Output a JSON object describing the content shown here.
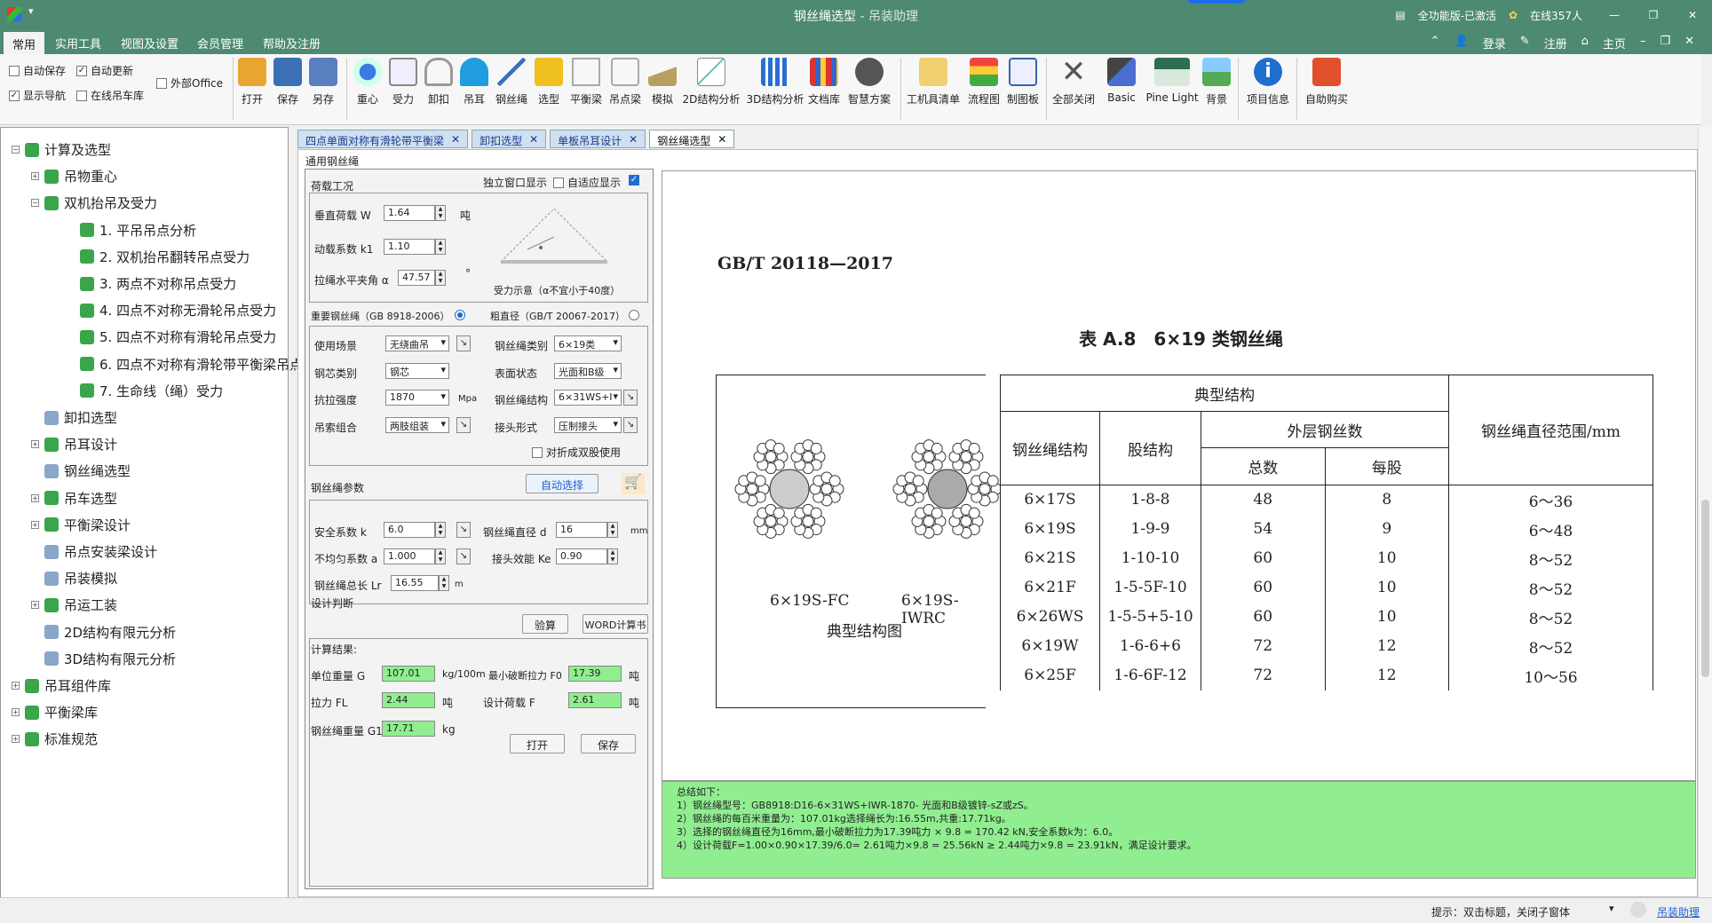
{
  "titlebar": {
    "title": "钢丝绳选型",
    "subtitle": "- 吊装助理",
    "version": "全功能版-已激活",
    "online": "在线357人"
  },
  "menu": {
    "items": [
      "常用",
      "实用工具",
      "视图及设置",
      "会员管理",
      "帮助及注册"
    ],
    "links": [
      "登录",
      "注册",
      "主页"
    ]
  },
  "ribbon": {
    "checks": [
      {
        "label": "自动保存",
        "checked": false
      },
      {
        "label": "自动更新",
        "checked": true
      },
      {
        "label": "外部Office",
        "checked": false
      },
      {
        "label": "显示导航",
        "checked": true
      },
      {
        "label": "在线吊车库",
        "checked": false
      }
    ],
    "buttons": [
      "打开",
      "保存",
      "另存",
      "重心",
      "受力",
      "卸扣",
      "吊耳",
      "钢丝绳",
      "选型",
      "平衡梁",
      "吊点梁",
      "模拟",
      "2D结构分析",
      "3D结构分析",
      "文档库",
      "智慧方案",
      "工机具清单",
      "流程图",
      "制图板",
      "全部关闭",
      "Basic",
      "Pine Light",
      "背景",
      "项目信息",
      "自助购买"
    ]
  },
  "tree": [
    {
      "label": "计算及选型",
      "level": 0,
      "exp": "−"
    },
    {
      "label": "吊物重心",
      "level": 1,
      "exp": "+"
    },
    {
      "label": "双机抬吊及受力",
      "level": 1,
      "exp": "−"
    },
    {
      "label": "1. 平吊吊点分析",
      "level": 2
    },
    {
      "label": "2. 双机抬吊翻转吊点受力",
      "level": 2
    },
    {
      "label": "3. 两点不对称吊点受力",
      "level": 2
    },
    {
      "label": "4. 四点不对称无滑轮吊点受力",
      "level": 2
    },
    {
      "label": "5. 四点不对称有滑轮吊点受力",
      "level": 2
    },
    {
      "label": "6. 四点不对称有滑轮带平衡梁吊点",
      "level": 2
    },
    {
      "label": "7. 生命线（绳）受力",
      "level": 2
    },
    {
      "label": "卸扣选型",
      "level": 1
    },
    {
      "label": "吊耳设计",
      "level": 1,
      "exp": "+"
    },
    {
      "label": "钢丝绳选型",
      "level": 1
    },
    {
      "label": "吊车选型",
      "level": 1,
      "exp": "+"
    },
    {
      "label": "平衡梁设计",
      "level": 1,
      "exp": "+"
    },
    {
      "label": "吊点安装梁设计",
      "level": 1
    },
    {
      "label": "吊装模拟",
      "level": 1
    },
    {
      "label": "吊运工装",
      "level": 1,
      "exp": "+"
    },
    {
      "label": "2D结构有限元分析",
      "level": 1
    },
    {
      "label": "3D结构有限元分析",
      "level": 1
    },
    {
      "label": "吊耳组件库",
      "level": 0,
      "exp": "+"
    },
    {
      "label": "平衡梁库",
      "level": 0,
      "exp": "+"
    },
    {
      "label": "标准规范",
      "level": 0,
      "exp": "+"
    }
  ],
  "tabs": [
    "四点单面对称有滑轮带平衡梁",
    "卸扣选型",
    "单板吊耳设计",
    "钢丝绳选型"
  ],
  "form": {
    "panel_title": "通用钢丝绳",
    "load_section": "荷载工况",
    "independent_window": "独立窗口显示",
    "adaptive": "自适应显示",
    "vertical_load_label": "垂直荷载 W",
    "vertical_load": "1.64",
    "unit_t": "吨",
    "dyn_label": "动载系数 k1",
    "dyn": "1.10",
    "angle_label": "拉绳水平夹角 α",
    "angle": "47.57",
    "deg": "°",
    "diagram_caption": "受力示意（α不宜小于40度）",
    "std1": "重要钢丝绳（GB 8918-2006）",
    "std2": "粗直径（GB/T 20067-2017）",
    "usage_label": "使用场景",
    "usage": "无绕曲吊",
    "rope_type_label": "钢丝绳类别",
    "rope_type": "6×19类",
    "core_label": "钢芯类别",
    "core": "钢芯",
    "surface_label": "表面状态",
    "surface": "光面和B级",
    "strength_label": "抗拉强度",
    "strength": "1870",
    "mpa": "Mpa",
    "structure_label": "钢丝绳结构",
    "structure": "6×31WS+I",
    "combo_label": "吊索组合",
    "combo": "两肢组装",
    "joint_label": "接头形式",
    "joint": "压制接头",
    "fold": "对折成双股使用",
    "params_section": "钢丝绳参数",
    "auto_select": "自动选择",
    "safety_label": "安全系数 k",
    "safety": "6.0",
    "diameter_label": "钢丝绳直径 d",
    "diameter": "16",
    "mm": "mm",
    "uneven_label": "不均匀系数 a",
    "uneven": "1.000",
    "eff_label": "接头效能 Ke",
    "eff": "0.90",
    "length_label": "钢丝绳总长 Lr",
    "length": "16.55",
    "m": "m",
    "design_judge": "设计判断",
    "verify": "验算",
    "word": "WORD计算书",
    "results_title": "计算结果:",
    "unit_weight_label": "单位重量 G",
    "unit_weight": "107.01",
    "unit_weight_unit": "kg/100m",
    "min_break_label": "最小破断拉力 F0",
    "min_break": "17.39",
    "t": "吨",
    "tension_label": "拉力 FL",
    "tension": "2.44",
    "design_load_label": "设计荷载 F",
    "design_load": "2.61",
    "rope_weight_label": "钢丝绳重量 G1",
    "rope_weight": "17.71",
    "kg": "kg",
    "open": "打开",
    "save": "保存"
  },
  "doc": {
    "std": "GB/T 20118—2017",
    "table_title": "表 A.8　6×19 类钢丝绳",
    "header_typical": "典型结构",
    "header_rope": "钢丝绳结构",
    "header_strand": "股结构",
    "header_outer": "外层钢丝数",
    "header_total": "总数",
    "header_per": "每股",
    "header_range": "钢丝绳直径范围/mm",
    "fig1": "6×19S-FC",
    "fig2": "6×19S-IWRC",
    "fig_caption": "典型结构图",
    "rows": [
      [
        "6×17S",
        "1-8-8",
        "48",
        "8",
        "6～36"
      ],
      [
        "6×19S",
        "1-9-9",
        "54",
        "9",
        "6～48"
      ],
      [
        "6×21S",
        "1-10-10",
        "60",
        "10",
        "8～52"
      ],
      [
        "6×21F",
        "1-5-5F-10",
        "60",
        "10",
        "8～52"
      ],
      [
        "6×26WS",
        "1-5-5+5-10",
        "60",
        "10",
        "8～52"
      ],
      [
        "6×19W",
        "1-6-6+6",
        "72",
        "12",
        "8～52"
      ],
      [
        "6×25F",
        "1-6-6F-12",
        "72",
        "12",
        "10～56"
      ]
    ]
  },
  "summary": {
    "title": "总结如下：",
    "lines": [
      "1）钢丝绳型号：GB8918:D16-6×31WS+IWR-1870- 光面和B级镀锌-sZ或zS。",
      "2）钢丝绳的每百米重量为：107.01kg选择绳长为:16.55m,共重:17.71kg。",
      "3）选择的钢丝绳直径为16mm,最小破断拉力为17.39吨力 × 9.8 = 170.42 kN,安全系数k为：6.0。",
      "4）设计荷载F=1.00×0.90×17.39/6.0= 2.61吨力×9.8 = 25.56kN ≥ 2.44吨力×9.8 = 23.91kN，满足设计要求。"
    ]
  },
  "status": {
    "hint": "提示：双击标题，关闭子窗体",
    "link": "吊装助理"
  },
  "colors": {
    "titlebar": "#4e8a72",
    "green_field": "#90ee90",
    "tab": "#cfe0f2"
  }
}
